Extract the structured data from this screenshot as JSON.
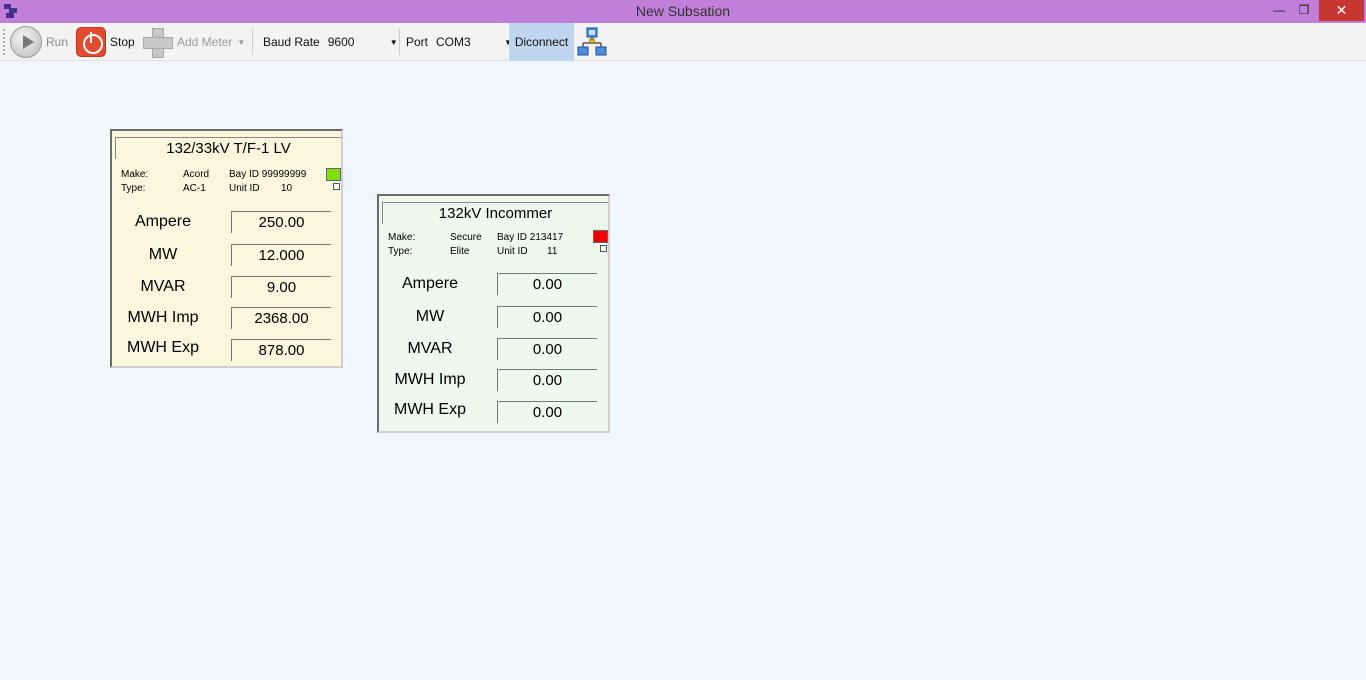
{
  "window": {
    "title": "New Subsation"
  },
  "toolbar": {
    "run_label": "Run",
    "stop_label": "Stop",
    "add_meter_label": "Add Meter",
    "baud_rate_label": "Baud Rate",
    "baud_rate_value": "9600",
    "port_label": "Port",
    "port_value": "COM3",
    "disconnect_label": "Diconnect"
  },
  "meters": [
    {
      "title": "132/33kV T/F-1 LV",
      "make_label": "Make:",
      "make": "Acord",
      "type_label": "Type:",
      "type": "AC-1",
      "bay_id": "Bay ID 99999999",
      "unit_id_label": "Unit ID",
      "unit_id": "10",
      "status_color": "#80e000",
      "readings": [
        {
          "label": "Ampere",
          "value": "250.00"
        },
        {
          "label": "MW",
          "value": "12.000"
        },
        {
          "label": "MVAR",
          "value": "9.00"
        },
        {
          "label": "MWH Imp",
          "value": "2368.00"
        },
        {
          "label": "MWH Exp",
          "value": "878.00"
        }
      ]
    },
    {
      "title": "132kV Incommer",
      "make_label": "Make:",
      "make": "Secure",
      "type_label": "Type:",
      "type": "Elite",
      "bay_id": "Bay ID 213417",
      "unit_id_label": "Unit ID",
      "unit_id": "11",
      "status_color": "#f00000",
      "readings": [
        {
          "label": "Ampere",
          "value": "0.00"
        },
        {
          "label": "MW",
          "value": "0.00"
        },
        {
          "label": "MVAR",
          "value": "0.00"
        },
        {
          "label": "MWH Imp",
          "value": "0.00"
        },
        {
          "label": "MWH Exp",
          "value": "0.00"
        }
      ]
    }
  ]
}
